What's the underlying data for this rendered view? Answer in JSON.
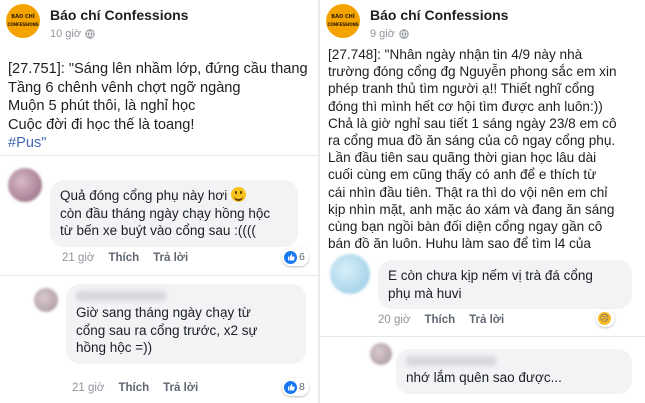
{
  "left": {
    "page_name": "Báo chí Confessions",
    "logo_text": [
      "BÁO CHÍ",
      "CONFESSIONS"
    ],
    "time": "10 giờ",
    "post_lines": [
      "[27.751]: \"Sáng lên nhầm lớp, đứng cầu thang",
      "Tầng 6 chênh vênh chợt ngỡ ngàng",
      "Muộn 5 phút thôi, là nghỉ học",
      "Cuộc đời đi học thế là toang!"
    ],
    "hashtag": "#Pus\"",
    "comments": [
      {
        "lines": [
          "Quả đóng cổng phụ này hơi",
          "còn đầu tháng ngày chạy hồng hộc",
          "từ bến xe buýt vào cổng sau :(((("
        ],
        "time": "21 giờ",
        "like": "Thích",
        "reply": "Trả lời",
        "reaction_count": "6"
      },
      {
        "lines": [
          "Giờ sang tháng ngày chạy từ",
          "cổng sau ra cổng trước, x2 sự",
          "hồng hộc =))"
        ],
        "time": "21 giờ",
        "like": "Thích",
        "reply": "Trả lời",
        "reaction_count": "8"
      }
    ]
  },
  "right": {
    "page_name": "Báo chí Confessions",
    "logo_text": [
      "BÁO CHÍ",
      "CONFESSIONS"
    ],
    "time": "9 giờ",
    "post_lines": [
      "[27.748]: \"Nhân ngày nhận tin 4/9 này nhà",
      "trường đóng cổng đg Nguyễn phong sắc em xin",
      "phép tranh thủ tìm người ạ!! Thiết nghĩ cổng",
      "đóng thì mình hết cơ hội tìm được anh luôn:))",
      "Chả là giờ nghỉ sau tiết 1 sáng ngày 23/8 em cô",
      "ra cổng mua đồ ăn sáng của cô ngay cổng phụ.",
      "Lần đầu tiên sau quãng thời gian học lâu dài",
      "cuối cùng em cũng thấy có anh để e thích từ",
      "cái nhìn đầu tiên. Thật ra thì do vội nên em chỉ",
      "kịp nhìn mặt, anh mặc áo xám và đang ăn sáng",
      "cùng bạn ngồi bàn đối diện cổng ngay gần cô",
      "bán đồ ăn luôn. Huhu làm sao để tìm l4 của"
    ],
    "comments": [
      {
        "lines": [
          "E còn  chưa kịp nếm vị trà đá cổng",
          "phụ mà huvi"
        ],
        "time": "20 giờ",
        "like": "Thích",
        "reply": "Trả lời"
      },
      {
        "lines": [
          "nhớ lắm quên sao được..."
        ]
      }
    ]
  },
  "colors": {
    "link": "#4267b2",
    "bubble": "#f2f3f5",
    "meta": "#90949c",
    "logo": "#f5a300"
  }
}
